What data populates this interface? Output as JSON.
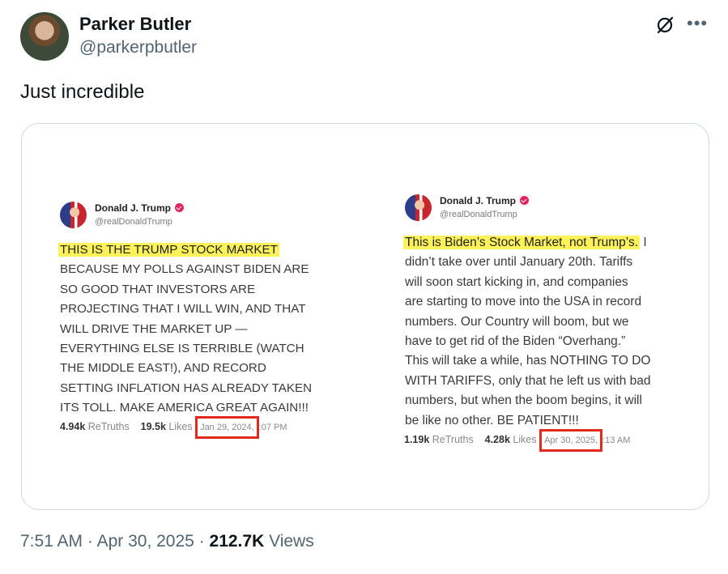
{
  "author": {
    "name": "Parker Butler",
    "handle": "@parkerpbutler"
  },
  "icons": {
    "grok": "grok-icon",
    "more": "more-options-icon"
  },
  "tweet": {
    "text": "Just incredible"
  },
  "embedded": {
    "post1": {
      "name": "Donald J. Trump",
      "handle": "@realDonaldTrump",
      "highlight": "THIS IS THE TRUMP STOCK MARKET",
      "lines": [
        "BECAUSE MY POLLS AGAINST BIDEN ARE",
        "SO GOOD THAT INVESTORS ARE",
        "PROJECTING THAT I WILL WIN, AND THAT",
        "WILL DRIVE THE MARKET UP —",
        "EVERYTHING ELSE IS TERRIBLE (WATCH",
        "THE MIDDLE EAST!), AND RECORD",
        "SETTING INFLATION HAS ALREADY TAKEN",
        "ITS TOLL. MAKE AMERICA GREAT AGAIN!!!"
      ],
      "retruths_count": "4.94k",
      "retruths_label": "ReTruths",
      "likes_count": "19.5k",
      "likes_label": "Likes",
      "date": "Jan 29, 2024,",
      "time": ":07 PM"
    },
    "post2": {
      "name": "Donald J. Trump",
      "handle": "@realDonaldTrump",
      "highlight": "This is Biden’s Stock Market, not Trump’s.",
      "first_line_rest": " I",
      "lines": [
        "didn’t take over until January 20th. Tariffs",
        "will soon start kicking in, and companies",
        "are starting to move into the USA in record",
        "numbers. Our Country will boom, but we",
        "have to get rid of the Biden “Overhang.”",
        "This will take a while, has NOTHING TO DO",
        "WITH TARIFFS, only that he left us with bad",
        "numbers, but when the boom begins, it will",
        "be like no other. BE PATIENT!!!"
      ],
      "retruths_count": "1.19k",
      "retruths_label": "ReTruths",
      "likes_count": "4.28k",
      "likes_label": "Likes",
      "date": "Apr 30, 2025,",
      "time": ":13 AM"
    }
  },
  "meta": {
    "time": "7:51 AM",
    "separator": " · ",
    "date": "Apr 30, 2025",
    "views_count": "212.7K",
    "views_label": " Views"
  }
}
